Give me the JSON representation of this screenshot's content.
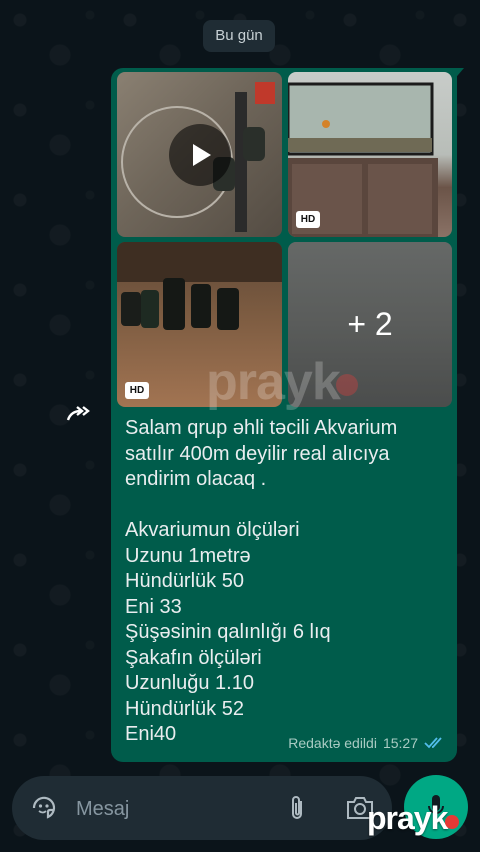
{
  "date_chip": "Bu gün",
  "media": {
    "more_count": "+ 2",
    "hd_badge": "HD"
  },
  "message": {
    "text": "Salam qrup əhli təcili Akvarium satılır 400m deyilir real alıcıya endirim olacaq .\n\nAkvariumun ölçüləri\nUzunu 1metrə\nHündürlük 50\nEni 33\nŞüşəsinin qalınlığı 6 lıq\nŞakafın ölçüləri\nUzunluğu 1.10\nHündürlük 52\nEni40",
    "edited_label": "Redaktə edildi",
    "time": "15:27",
    "status_icon": "double-check-read-icon"
  },
  "composer": {
    "placeholder": "Mesaj"
  },
  "watermark": "prayk",
  "logo": "prayk",
  "colors": {
    "background": "#0b141a",
    "bubble": "#005c4b",
    "composer": "#1f2c34",
    "accent": "#00a884",
    "read_tick": "#53bdeb"
  }
}
